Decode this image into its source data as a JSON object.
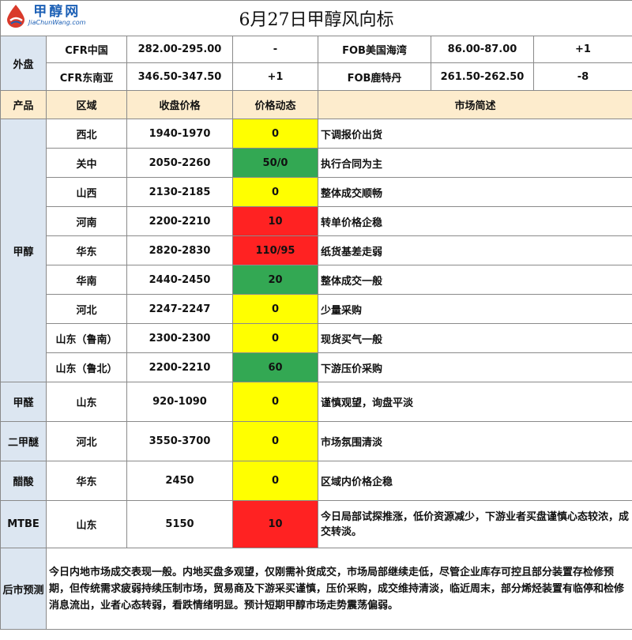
{
  "header": {
    "logo_text": "甲醇网",
    "logo_sub": "JiaChunWang.com",
    "title": "6月27日甲醇风向标"
  },
  "external": {
    "label": "外盘",
    "rows": [
      {
        "left_name": "CFR中国",
        "left_price": "282.00-295.00",
        "left_change": "-",
        "right_name": "FOB美国海湾",
        "right_price": "86.00-87.00",
        "right_change": "+1"
      },
      {
        "left_name": "CFR东南亚",
        "left_price": "346.50-347.50",
        "left_change": "+1",
        "right_name": "FOB鹿特丹",
        "right_price": "261.50-262.50",
        "right_change": "-8"
      }
    ]
  },
  "columns": {
    "product": "产品",
    "region": "区域",
    "price": "收盘价格",
    "change": "价格动态",
    "summary": "市场简述"
  },
  "colors": {
    "yellow": "#ffff00",
    "green": "#33a853",
    "red": "#ff2222"
  },
  "methanol": {
    "product": "甲醇",
    "rows": [
      {
        "region": "西北",
        "price": "1940-1970",
        "change": "0",
        "status": "yellow",
        "summary": "下调报价出货"
      },
      {
        "region": "关中",
        "price": "2050-2260",
        "change": "50/0",
        "status": "green",
        "summary": "执行合同为主"
      },
      {
        "region": "山西",
        "price": "2130-2185",
        "change": "0",
        "status": "yellow",
        "summary": "整体成交顺畅"
      },
      {
        "region": "河南",
        "price": "2200-2210",
        "change": "10",
        "status": "red",
        "summary": "转单价格企稳"
      },
      {
        "region": "华东",
        "price": "2820-2830",
        "change": "110/95",
        "status": "red",
        "summary": "纸货基差走弱"
      },
      {
        "region": "华南",
        "price": "2440-2450",
        "change": "20",
        "status": "green",
        "summary": "整体成交一般"
      },
      {
        "region": "河北",
        "price": "2247-2247",
        "change": "0",
        "status": "yellow",
        "summary": "少量采购"
      },
      {
        "region": "山东（鲁南）",
        "price": "2300-2300",
        "change": "0",
        "status": "yellow",
        "summary": "现货买气一般"
      },
      {
        "region": "山东（鲁北）",
        "price": "2200-2210",
        "change": "60",
        "status": "green",
        "summary": "下游压价采购"
      }
    ]
  },
  "others": [
    {
      "product": "甲醛",
      "region": "山东",
      "price": "920-1090",
      "change": "0",
      "status": "yellow",
      "summary": "谨慎观望，询盘平淡"
    },
    {
      "product": "二甲醚",
      "region": "河北",
      "price": "3550-3700",
      "change": "0",
      "status": "yellow",
      "summary": "市场氛围清淡"
    },
    {
      "product": "醋酸",
      "region": "华东",
      "price": "2450",
      "change": "0",
      "status": "yellow",
      "summary": "区域内价格企稳"
    },
    {
      "product": "MTBE",
      "region": "山东",
      "price": "5150",
      "change": "10",
      "status": "red",
      "summary": "今日局部试探推涨，低价资源减少，下游业者买盘谨慎心态较浓，成交转淡。"
    }
  ],
  "forecast": {
    "label": "后市预测",
    "text": "今日内地市场成交表现一般。内地买盘多观望，仅刚需补货成交，市场局部继续走低，尽管企业库存可控且部分装置存检修预期，但传统需求疲弱持续压制市场，贸易商及下游采买谨慎，压价采购，成交维持清淡，临近周末，部分烯烃装置有临停和检修消息流出，业者心态转弱，看跌情绪明显。预计短期甲醇市场走势震荡偏弱。"
  }
}
